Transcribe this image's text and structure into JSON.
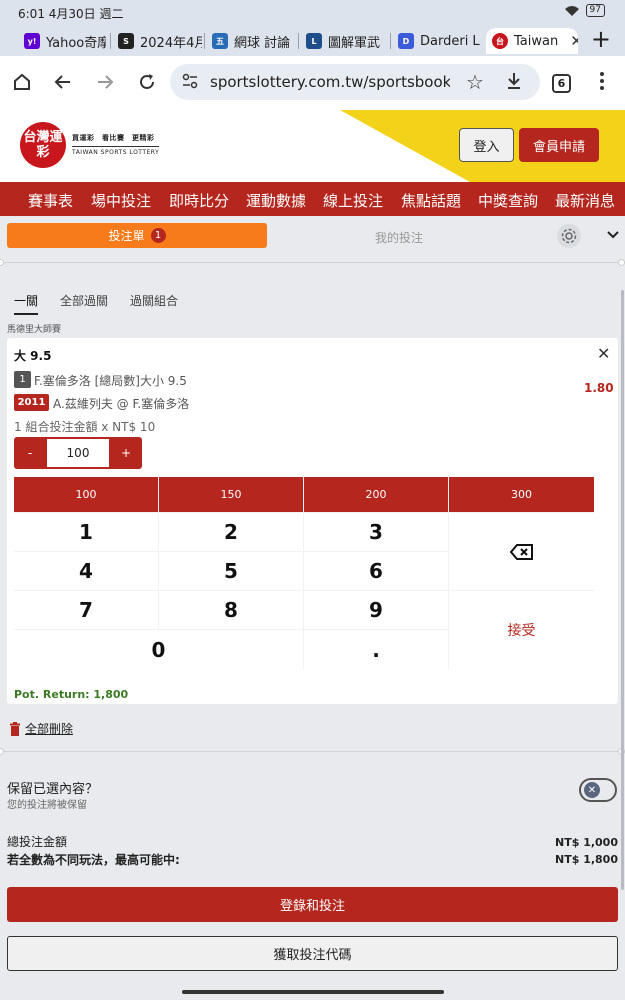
{
  "status_bar": {
    "time": "6:01 4月30日 週二",
    "battery": "97"
  },
  "browser_tabs": [
    {
      "label": "Yahoo奇摩",
      "favicon": "yahoo-favicon",
      "color": "#5f01d1"
    },
    {
      "label": "2024年4月",
      "favicon": "news-favicon",
      "color": "#222222"
    },
    {
      "label": "網球 討論",
      "favicon": "forum-favicon",
      "color": "#2a6bb5"
    },
    {
      "label": "圖解軍武",
      "favicon": "ltn-favicon",
      "color": "#1d4e89"
    },
    {
      "label": "Darderi L",
      "favicon": "doc-favicon",
      "color": "#3b5bdb"
    },
    {
      "label": "Taiwan",
      "favicon": "sportslottery-favicon",
      "color": "#c8161d",
      "active": true
    }
  ],
  "address_bar": {
    "url": "sportslottery.com.tw/sportsbook/spo",
    "tab_count": "6"
  },
  "site": {
    "logo_text": "台灣運彩",
    "logo_slogan": "買運彩　看比賽　更精彩",
    "logo_english": "TAIWAN SPORTS LOTTERY",
    "login_label": "登入",
    "register_label": "會員申請"
  },
  "main_nav": [
    "賽事表",
    "場中投注",
    "即時比分",
    "運動數據",
    "線上投注",
    "焦點話題",
    "中獎查詢",
    "最新消息"
  ],
  "betslip": {
    "tab_active": "投注單",
    "badge": "1",
    "tab_mine": "我的投注",
    "pool_tabs": [
      "一關",
      "全部過關",
      "過關組合"
    ],
    "league": "馬德里大師賽",
    "selection_title": "大 9.5",
    "leg_number": "1",
    "leg_desc": "F.塞倫多洛 [總局數]大小 9.5",
    "odds": "1.80",
    "match_id": "2011",
    "match_desc": "A.茲維列夫 @ F.塞倫多洛",
    "stake_info": "1 組合投注金額 x NT$ 10",
    "stepper": {
      "minus": "-",
      "value": "100",
      "plus": "+"
    },
    "quick_amounts": [
      "100",
      "150",
      "200",
      "300"
    ],
    "keys": [
      "1",
      "2",
      "3",
      "4",
      "5",
      "6",
      "7",
      "8",
      "9",
      "0",
      "."
    ],
    "accept_label": "接受",
    "potential_return": "Pot. Return: 1,800"
  },
  "delete_all": "全部刪除",
  "keep": {
    "title": "保留已選內容？",
    "subtitle": "您的投注將被保留"
  },
  "summary": {
    "total_label": "總投注金額",
    "total_value": "NT$ 1,000",
    "max_label": "若全數為不同玩法，最高可能中:",
    "max_value": "NT$ 1,800"
  },
  "buttons": {
    "submit": "登錄和投注",
    "get_code": "獲取投注代碼"
  },
  "colors": {
    "brand_red": "#b5261e",
    "orange": "#f77b1b",
    "yellow": "#f3d21a",
    "return_green": "#3c7a25"
  }
}
